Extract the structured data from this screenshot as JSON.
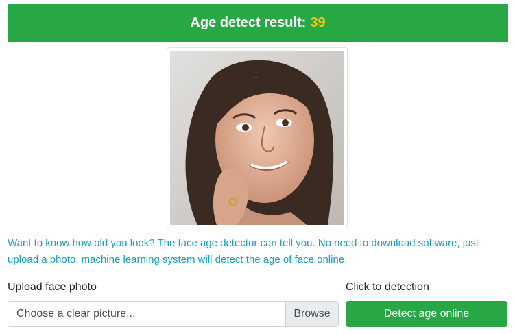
{
  "result": {
    "label": "Age detect result:",
    "value": "39",
    "value_color": "#ffc107",
    "banner_color": "#28a745"
  },
  "photo": {
    "alt": "Face photo"
  },
  "description": "Want to know how old you look? The face age detector can tell you. No need to download software, just upload a photo, machine learning system will detect the age of face online.",
  "upload": {
    "label": "Upload face photo",
    "placeholder": "Choose a clear picture...",
    "browse_label": "Browse"
  },
  "detect": {
    "label": "Click to detection",
    "button_label": "Detect age online"
  }
}
